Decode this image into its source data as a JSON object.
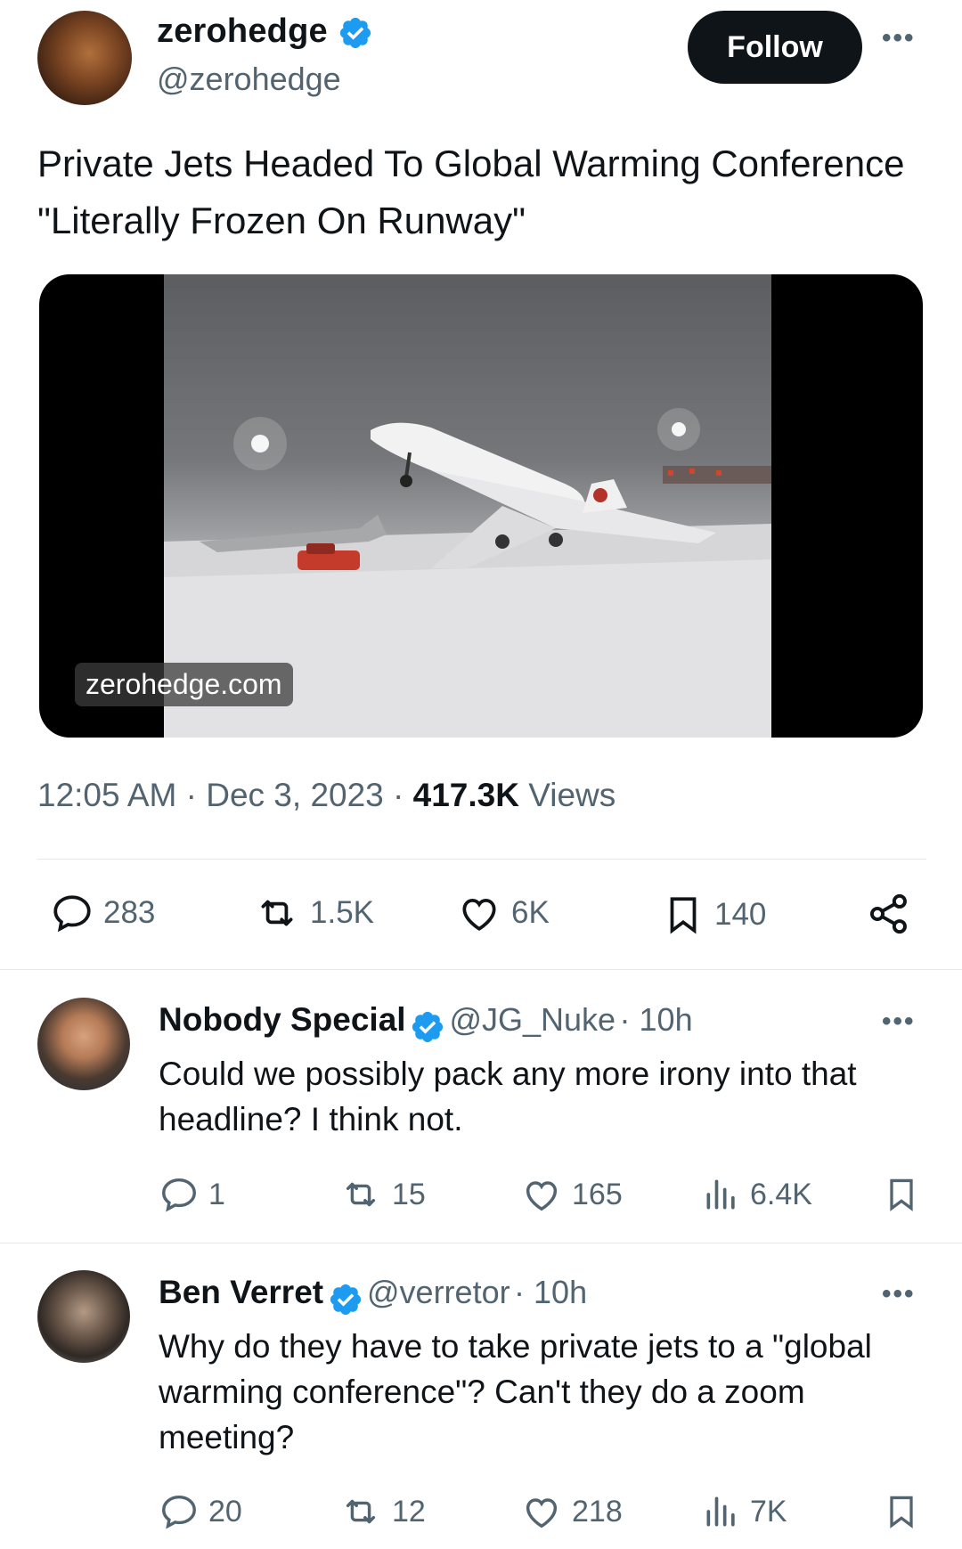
{
  "main_tweet": {
    "display_name": "zerohedge",
    "handle": "@zerohedge",
    "follow_label": "Follow",
    "more_label": "•••",
    "text": "Private Jets Headed To Global Warming Conference \"Literally Frozen On Runway\"",
    "media_caption": "zerohedge.com",
    "time": "12:05 AM",
    "separator": "·",
    "date": "Dec 3, 2023",
    "views_count": "417.3K",
    "views_label": "Views",
    "stats": {
      "replies": "283",
      "reposts": "1.5K",
      "likes": "6K",
      "bookmarks": "140"
    }
  },
  "replies": [
    {
      "display_name": "Nobody Special",
      "handle": "@JG_Nuke",
      "time": "· 10h",
      "text": "Could we possibly pack any more irony into that headline? I think not.",
      "more_label": "•••",
      "stats": {
        "replies": "1",
        "reposts": "15",
        "likes": "165",
        "views": "6.4K"
      }
    },
    {
      "display_name": "Ben Verret",
      "handle": "@verretor",
      "time": "· 10h",
      "text": "Why do they have to take private jets to a \"global warming conference\"? Can't they do a zoom meeting?",
      "more_label": "•••",
      "stats": {
        "replies": "20",
        "reposts": "12",
        "likes": "218",
        "views": "7K"
      }
    }
  ],
  "colors": {
    "text": "#0f1419",
    "muted": "#536471",
    "verified_blue": "#1d9bf0",
    "follow_bg": "#0f1419"
  },
  "icons": [
    "verified-badge-icon",
    "reply-icon",
    "repost-icon",
    "like-icon",
    "bookmark-icon",
    "share-icon",
    "views-icon",
    "more-icon"
  ]
}
